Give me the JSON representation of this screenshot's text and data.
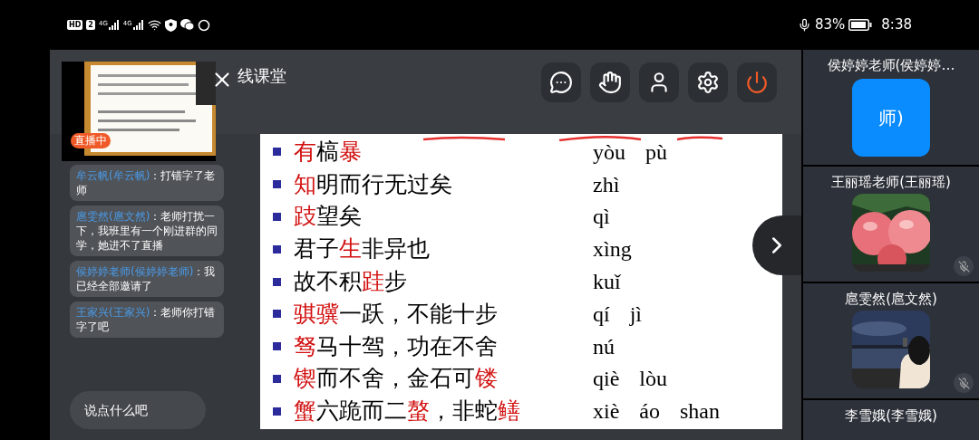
{
  "status_bar": {
    "network_badge": "HD",
    "sim_badge": "2",
    "signals": [
      "4G",
      "4G"
    ],
    "battery": "83%",
    "time": "8:38"
  },
  "header": {
    "title": "线课堂"
  },
  "toolbar": [
    {
      "kind": "chat"
    },
    {
      "kind": "hand"
    },
    {
      "kind": "person"
    },
    {
      "kind": "settings"
    },
    {
      "kind": "power"
    }
  ],
  "live_preview": {
    "badge": "直播中"
  },
  "chat": {
    "messages": [
      {
        "sender": "牟云帆(牟云帆)",
        "text": "：打错字了老师"
      },
      {
        "sender": "扈雯然(扈文然)",
        "text": "：老师打扰一下，我班里有一个刚进群的同学，她进不了直播"
      },
      {
        "sender": "侯婷婷老师(侯婷婷老师)",
        "text": "：我已经全部邀请了"
      },
      {
        "sender": "王家兴(王家兴)",
        "text": "：老师你打错字了吧"
      }
    ],
    "input": {
      "placeholder": "说点什么吧"
    }
  },
  "slide": {
    "lines": [
      {
        "segments": [
          {
            "text": "有",
            "red": true
          },
          {
            "text": "槁",
            "red": false
          },
          {
            "text": "暴",
            "red": true
          }
        ],
        "pinyin": [
          "yòu",
          "pù"
        ]
      },
      {
        "segments": [
          {
            "text": "知",
            "red": true
          },
          {
            "text": "明而行无过矣",
            "red": false
          }
        ],
        "pinyin": [
          "zhì"
        ]
      },
      {
        "segments": [
          {
            "text": "跂",
            "red": true
          },
          {
            "text": "望矣",
            "red": false
          }
        ],
        "pinyin": [
          "qì"
        ]
      },
      {
        "segments": [
          {
            "text": "君子",
            "red": false
          },
          {
            "text": "生",
            "red": true
          },
          {
            "text": "非异也",
            "red": false
          }
        ],
        "pinyin": [
          "xìng"
        ]
      },
      {
        "segments": [
          {
            "text": "故不积",
            "red": false
          },
          {
            "text": "跬",
            "red": true
          },
          {
            "text": "步",
            "red": false
          }
        ],
        "pinyin": [
          "kuǐ"
        ]
      },
      {
        "segments": [
          {
            "text": "骐骥",
            "red": true
          },
          {
            "text": "一跃，不能十步",
            "red": false
          }
        ],
        "pinyin": [
          "qí",
          "jì"
        ]
      },
      {
        "segments": [
          {
            "text": "驽",
            "red": true
          },
          {
            "text": "马十驾，功在不舍",
            "red": false
          }
        ],
        "pinyin": [
          "nú"
        ]
      },
      {
        "segments": [
          {
            "text": "锲",
            "red": true
          },
          {
            "text": "而不舍，金石可",
            "red": false
          },
          {
            "text": "镂",
            "red": true
          }
        ],
        "pinyin": [
          "qiè",
          "lòu"
        ]
      },
      {
        "segments": [
          {
            "text": "蟹",
            "red": true
          },
          {
            "text": "六跪而二",
            "red": false
          },
          {
            "text": "螯",
            "red": true
          },
          {
            "text": "，非蛇",
            "red": false
          },
          {
            "text": "鳝",
            "red": true
          }
        ],
        "pinyin": [
          "xiè",
          "áo",
          "shan"
        ]
      }
    ]
  },
  "participants": [
    {
      "name": "侯婷婷老师(侯婷婷…",
      "avatar": {
        "kind": "text",
        "text": "师)"
      },
      "muted": false
    },
    {
      "name": "王丽瑶老师(王丽瑶)",
      "avatar": {
        "kind": "apples"
      },
      "muted": true
    },
    {
      "name": "扈雯然(扈文然)",
      "avatar": {
        "kind": "lake"
      },
      "muted": true
    },
    {
      "name": "李雪娥(李雪娥)",
      "muted": false
    }
  ]
}
